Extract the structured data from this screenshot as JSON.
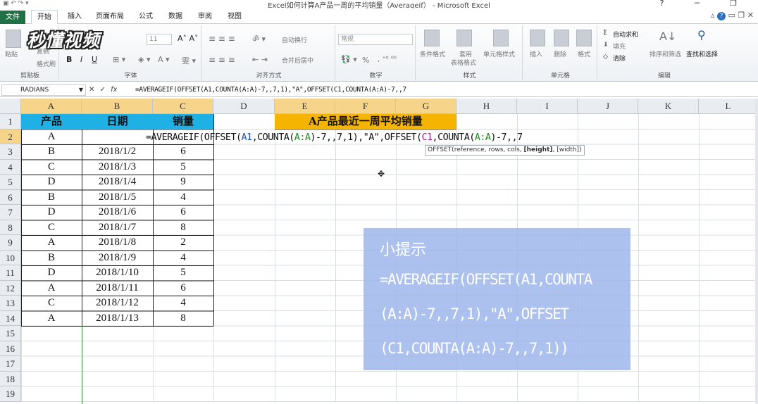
{
  "window": {
    "title": "Excel如何计算A产品一周的平均销量（Averageif） - Microsoft Excel"
  },
  "ribbon_tabs": [
    "文件",
    "开始",
    "插入",
    "页面布局",
    "公式",
    "数据",
    "审阅",
    "视图"
  ],
  "ribbon": {
    "clipboard": {
      "paste": "粘贴",
      "copy": "复制",
      "format_painter": "格式刷",
      "label": "剪贴板"
    },
    "font": {
      "font_size": "11",
      "label": "字体"
    },
    "alignment": {
      "wrap": "自动换行",
      "merge": "合并后居中",
      "label": "对齐方式"
    },
    "number": {
      "format": "常规",
      "percent": "%",
      "label": "数字"
    },
    "styles": {
      "conditional": "条件格式",
      "table": "套用\n表格格式",
      "table_l1": "套用",
      "table_l2": "表格格式",
      "cell_styles": "单元格样式",
      "label": "样式"
    },
    "cells": {
      "insert": "插入",
      "delete": "删除",
      "format": "格式",
      "label": "单元格"
    },
    "editing": {
      "autosum": "自动求和",
      "fill": "填充",
      "clear": "清除",
      "sort_filter": "排序和筛选",
      "find_select": "查找和选择",
      "label": "编辑"
    }
  },
  "logo": "秒懂视频",
  "formula_bar": {
    "name_box": "RADIANS",
    "cancel": "✕",
    "enter": "✓",
    "fx": "fx",
    "formula": "=AVERAGEIF(OFFSET(A1,COUNTA(A:A)-7,,7,1),\"A\",OFFSET(C1,COUNTA(A:A)-7,,7"
  },
  "columns": [
    "A",
    "B",
    "C",
    "D",
    "E",
    "F",
    "G",
    "H",
    "I",
    "J",
    "K",
    "L"
  ],
  "rows": [
    "1",
    "2",
    "3",
    "4",
    "5",
    "6",
    "7",
    "8",
    "9",
    "10",
    "11",
    "12",
    "13",
    "14",
    "15",
    "16",
    "17",
    "18",
    "19"
  ],
  "headers": {
    "a1": "产品",
    "b1": "日期",
    "c1": "销量",
    "e1": "A产品最近一周平均销量"
  },
  "table": [
    {
      "product": "A",
      "date": "",
      "sales": ""
    },
    {
      "product": "B",
      "date": "2018/1/2",
      "sales": "6"
    },
    {
      "product": "C",
      "date": "2018/1/3",
      "sales": "5"
    },
    {
      "product": "D",
      "date": "2018/1/4",
      "sales": "9"
    },
    {
      "product": "B",
      "date": "2018/1/5",
      "sales": "4"
    },
    {
      "product": "D",
      "date": "2018/1/6",
      "sales": "6"
    },
    {
      "product": "C",
      "date": "2018/1/7",
      "sales": "8"
    },
    {
      "product": "A",
      "date": "2018/1/8",
      "sales": "2"
    },
    {
      "product": "B",
      "date": "2018/1/9",
      "sales": "4"
    },
    {
      "product": "D",
      "date": "2018/1/10",
      "sales": "5"
    },
    {
      "product": "A",
      "date": "2018/1/11",
      "sales": "6"
    },
    {
      "product": "C",
      "date": "2018/1/12",
      "sales": "4"
    },
    {
      "product": "A",
      "date": "2018/1/13",
      "sales": "8"
    }
  ],
  "editing_cell": {
    "p0": "=AVERAGEIF(OFFSET(",
    "p1": "A1",
    "p2": ",COUNTA(",
    "p3": "A:A",
    "p4": ")-7,,7,1),\"A\",OFFSET(",
    "p5": "C1",
    "p6": ",COUNTA(",
    "p7": "A:A",
    "p8": ")-7,,7"
  },
  "tooltip": {
    "pre": "OFFSET(reference, rows, cols, ",
    "bold": "[height]",
    "post": ", [width])"
  },
  "hint": {
    "title": "小提示",
    "line1": "=AVERAGEIF(OFFSET(A1,COUNTA",
    "line2": "(A:A)-7,,7,1),\"A\",OFFSET",
    "line3": "(C1,COUNTA(A:A)-7,,7,1))"
  }
}
